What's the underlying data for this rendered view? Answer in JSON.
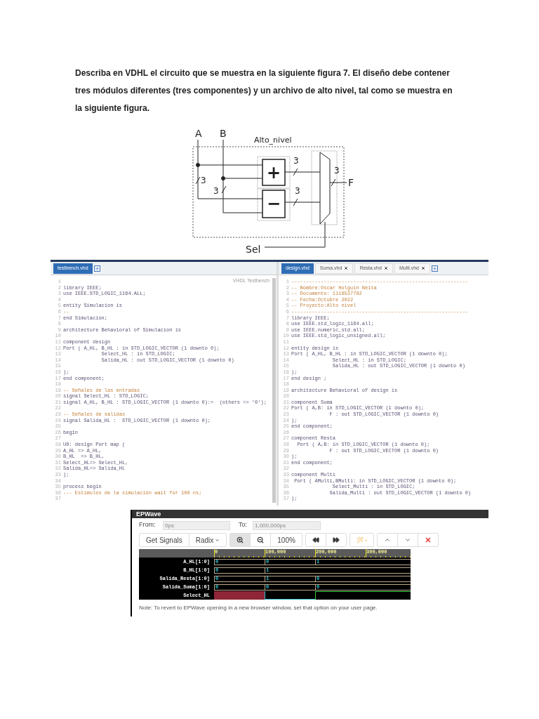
{
  "instructions": "Describa en VDHL el circuito que se muestra en la siguiente figura 7. El diseño debe contener tres módulos diferentes (tres componentes) y un archivo de alto nivel, tal como se muestra en la siguiente figura.",
  "diagram": {
    "title": "Alto_nivel",
    "inputs": [
      "A",
      "B"
    ],
    "blocks": [
      "+",
      "−"
    ],
    "widths": [
      "3",
      "3",
      "3",
      "3",
      "3"
    ],
    "output": "F",
    "select": "Sel"
  },
  "editor": {
    "panes": [
      {
        "tabs": [
          {
            "label": "testbench.vhd",
            "selected": true,
            "closable": false
          }
        ],
        "mode": "VHDL Testbench",
        "lines": [
          {
            "n": "1"
          },
          {
            "n": "2",
            "kind": "code",
            "text": "library IEEE;"
          },
          {
            "n": "3",
            "kind": "code",
            "text": "use IEEE.STD_LOGIC_1164.ALL;"
          },
          {
            "n": "4"
          },
          {
            "n": "5",
            "kind": "code",
            "text": "entity Simulacion is"
          },
          {
            "n": "6",
            "kind": "comment",
            "text": "--"
          },
          {
            "n": "7",
            "kind": "code",
            "text": "end Simulacion;"
          },
          {
            "n": "8"
          },
          {
            "n": "9",
            "kind": "code",
            "text": "architecture Behavioral of Simulacion is"
          },
          {
            "n": "10"
          },
          {
            "n": "11",
            "kind": "code",
            "text": "component design"
          },
          {
            "n": "12",
            "kind": "code",
            "text": "Port ( A_HL, B_HL : in STD_LOGIC_VECTOR (1 downto 0);"
          },
          {
            "n": "13",
            "kind": "code",
            "text": "             Select_HL : in STD_LOGIC;"
          },
          {
            "n": "14",
            "kind": "code",
            "text": "             Salida_HL : out STD_LOGIC_VECTOR (1 downto 0)"
          },
          {
            "n": "15"
          },
          {
            "n": "16",
            "kind": "code",
            "text": ");"
          },
          {
            "n": "17",
            "kind": "code",
            "text": "end component;"
          },
          {
            "n": "18"
          },
          {
            "n": "19",
            "kind": "comment",
            "text": "-- Señales de las entradas"
          },
          {
            "n": "20",
            "kind": "code",
            "text": "signal Select_HL : STD_LOGIC;"
          },
          {
            "n": "21",
            "kind": "code",
            "text": "signal A_HL, B_HL : STD_LOGIC_VECTOR (1 downto 0):=  (others => '0');"
          },
          {
            "n": "22"
          },
          {
            "n": "23",
            "kind": "comment",
            "text": "-- Señales de salidas"
          },
          {
            "n": "24",
            "kind": "code",
            "text": "signal Salida_HL :  STD_LOGIC_VECTOR (1 downto 0);"
          },
          {
            "n": "25"
          },
          {
            "n": "26",
            "kind": "code",
            "text": "begin"
          },
          {
            "n": "27"
          },
          {
            "n": "28",
            "kind": "code",
            "text": "U0: design Port map ("
          },
          {
            "n": "29",
            "kind": "code",
            "text": "A_HL => A_HL,"
          },
          {
            "n": "30",
            "kind": "code",
            "text": "B_HL  => B_HL,"
          },
          {
            "n": "31",
            "kind": "code",
            "text": "Select_HL=> Select_HL,"
          },
          {
            "n": "32",
            "kind": "code",
            "text": "Salida_HL=> Salida_HL"
          },
          {
            "n": "33",
            "kind": "code",
            "text": ");"
          },
          {
            "n": "34"
          },
          {
            "n": "35",
            "kind": "code",
            "text": "process begin"
          },
          {
            "n": "36",
            "kind": "comment",
            "text": "--- Estímulos de la simulación wait for 100 ns;"
          },
          {
            "n": "37"
          }
        ]
      },
      {
        "tabs": [
          {
            "label": "design.vhd",
            "selected": true,
            "closable": false
          },
          {
            "label": "Suma.vhd",
            "selected": false,
            "closable": true
          },
          {
            "label": "Resta.vhd",
            "selected": false,
            "closable": true
          },
          {
            "label": "Multi.vhd",
            "selected": false,
            "closable": true
          }
        ],
        "lines": [
          {
            "n": "1",
            "kind": "comment",
            "text": "------------------------------------------------------------"
          },
          {
            "n": "2",
            "kind": "comment",
            "text": "-- Nombre:Oscar Holguin Neita"
          },
          {
            "n": "3",
            "kind": "comment",
            "text": "-- Documento: 1118537782"
          },
          {
            "n": "4",
            "kind": "comment",
            "text": "-- Fecha:Octubre 2022"
          },
          {
            "n": "5",
            "kind": "comment",
            "text": "-- Proyecto:Alto nivel"
          },
          {
            "n": "6",
            "kind": "comment",
            "text": "------------------------------------------------------------"
          },
          {
            "n": "7",
            "kind": "code",
            "text": "library IEEE;"
          },
          {
            "n": "8",
            "kind": "code",
            "text": "use IEEE.std_logic_1164.all;"
          },
          {
            "n": "9",
            "kind": "code",
            "text": "use IEEE.numeric_std.all;"
          },
          {
            "n": "10",
            "kind": "code",
            "text": "use IEEE.std_logic_unsigned.all;"
          },
          {
            "n": "11"
          },
          {
            "n": "12",
            "kind": "code",
            "text": "entity design is"
          },
          {
            "n": "13",
            "kind": "code",
            "text": "Port ( A_HL, B_HL : in STD_LOGIC_VECTOR (1 downto 0);"
          },
          {
            "n": "14",
            "kind": "code",
            "text": "              Select_HL : in STD_LOGIC;"
          },
          {
            "n": "15",
            "kind": "code",
            "text": "              Salida_HL : out STD_LOGIC_VECTOR (1 downto 0)"
          },
          {
            "n": "16",
            "kind": "code",
            "text": ");"
          },
          {
            "n": "17",
            "kind": "code",
            "text": "end design ;"
          },
          {
            "n": "18"
          },
          {
            "n": "19",
            "kind": "code",
            "text": "architecture Behavioral of design is"
          },
          {
            "n": "20"
          },
          {
            "n": "21",
            "kind": "code",
            "text": "component Suma"
          },
          {
            "n": "22",
            "kind": "code",
            "text": "Port ( A,B: in STD_LOGIC_VECTOR (1 downto 0);"
          },
          {
            "n": "23",
            "kind": "code",
            "text": "             F : out STD_LOGIC_VECTOR (1 downto 0)"
          },
          {
            "n": "24",
            "kind": "code",
            "text": ");"
          },
          {
            "n": "25",
            "kind": "code",
            "text": "end component;"
          },
          {
            "n": "26"
          },
          {
            "n": "27",
            "kind": "code",
            "text": "component Resta"
          },
          {
            "n": "28",
            "kind": "code",
            "text": "  Port ( A,B: in STD_LOGIC_VECTOR (1 downto 0);"
          },
          {
            "n": "29",
            "kind": "code",
            "text": "             F : out STD_LOGIC_VECTOR (1 downto 0)"
          },
          {
            "n": "30",
            "kind": "code",
            "text": ");"
          },
          {
            "n": "31",
            "kind": "code",
            "text": "end component;"
          },
          {
            "n": "32"
          },
          {
            "n": "33",
            "kind": "code",
            "text": "component Multi"
          },
          {
            "n": "34",
            "kind": "code",
            "text": " Port ( AMulti,BMulti: in STD_LOGIC_VECTOR (1 downto 0);"
          },
          {
            "n": "35",
            "kind": "code",
            "text": "              Select_Multi : in STD_LOGIC;"
          },
          {
            "n": "36",
            "kind": "code",
            "text": "             Salida_Multi : out STD_LOGIC_VECTOR (1 downto 0)"
          },
          {
            "n": "37",
            "kind": "code",
            "text": ");"
          }
        ]
      }
    ]
  },
  "epwave": {
    "title": "EPWave",
    "from": {
      "label": "From:",
      "value": "0ps"
    },
    "to": {
      "label": "To:",
      "value": "1,000,000ps"
    },
    "toolbar": [
      {
        "buttons": [
          {
            "kind": "text",
            "label": "Get Signals",
            "pressed": false,
            "disabled": false
          },
          {
            "kind": "dropdown",
            "label": "Radix",
            "pressed": false,
            "disabled": false
          }
        ]
      },
      {
        "buttons": [
          {
            "kind": "zoom-in",
            "pressed": true,
            "disabled": false
          },
          {
            "kind": "zoom-out",
            "pressed": false,
            "disabled": false
          },
          {
            "kind": "text",
            "label": "100%",
            "pressed": false,
            "disabled": false
          }
        ]
      },
      {
        "buttons": [
          {
            "kind": "rewind",
            "pressed": false,
            "disabled": false
          },
          {
            "kind": "forward",
            "pressed": false,
            "disabled": false
          }
        ]
      },
      {
        "buttons": [
          {
            "kind": "cursor",
            "pressed": false,
            "disabled": true
          }
        ]
      },
      {
        "buttons": [
          {
            "kind": "up",
            "pressed": false,
            "disabled": false
          },
          {
            "kind": "down",
            "pressed": false,
            "disabled": false
          },
          {
            "kind": "delete",
            "pressed": false,
            "disabled": false
          }
        ]
      }
    ],
    "ticks": [
      "0",
      "100,000",
      "200,000",
      "300,000"
    ],
    "signals": [
      {
        "name": "A_HL[1:0]",
        "kind": "bus",
        "values": [
          "0",
          "0",
          "1"
        ]
      },
      {
        "name": "B_HL[1:0]",
        "kind": "bus",
        "values": [
          "0",
          "1"
        ]
      },
      {
        "name": "Salida_Resta[1:0]",
        "kind": "bus",
        "values": [
          "0",
          "1",
          "0"
        ]
      },
      {
        "name": "Salida_Suma[1:0]",
        "kind": "bus",
        "values": [
          "0",
          "0",
          "0"
        ]
      },
      {
        "name": "Select_HL",
        "kind": "bit",
        "segments": [
          {
            "kind": "unknown"
          },
          {
            "kind": "low"
          },
          {
            "kind": "high"
          }
        ]
      }
    ],
    "note": "Note: To revert to EPWave opening in a new browser window, set that option on your user page."
  }
}
